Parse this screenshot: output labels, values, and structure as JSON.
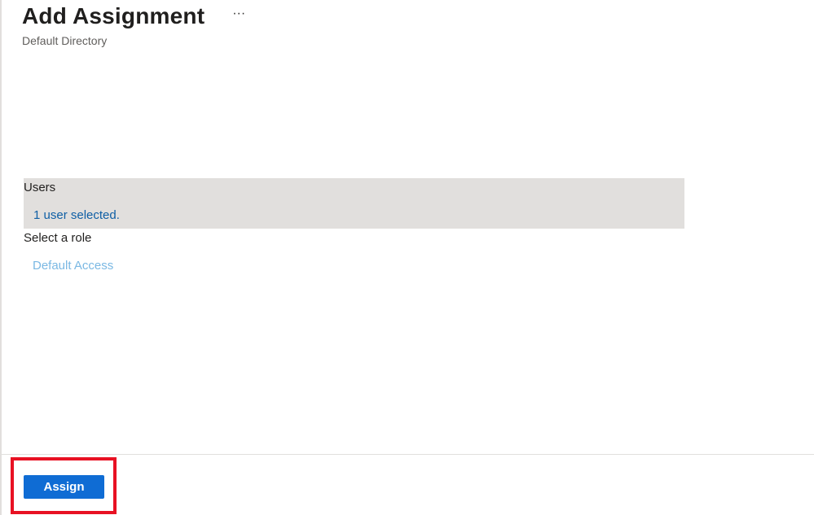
{
  "header": {
    "title": "Add Assignment",
    "more_label": "···",
    "subtitle": "Default Directory"
  },
  "users": {
    "label": "Users",
    "selected_text": "1 user selected."
  },
  "role": {
    "label": "Select a role",
    "selected_text": "Default Access"
  },
  "footer": {
    "assign_label": "Assign"
  },
  "colors": {
    "accent": "#0f6cd4",
    "link": "#0f5fa5",
    "link_light": "#7ab8e3",
    "highlight_border": "#e81123",
    "users_background": "#e1dfdd"
  }
}
